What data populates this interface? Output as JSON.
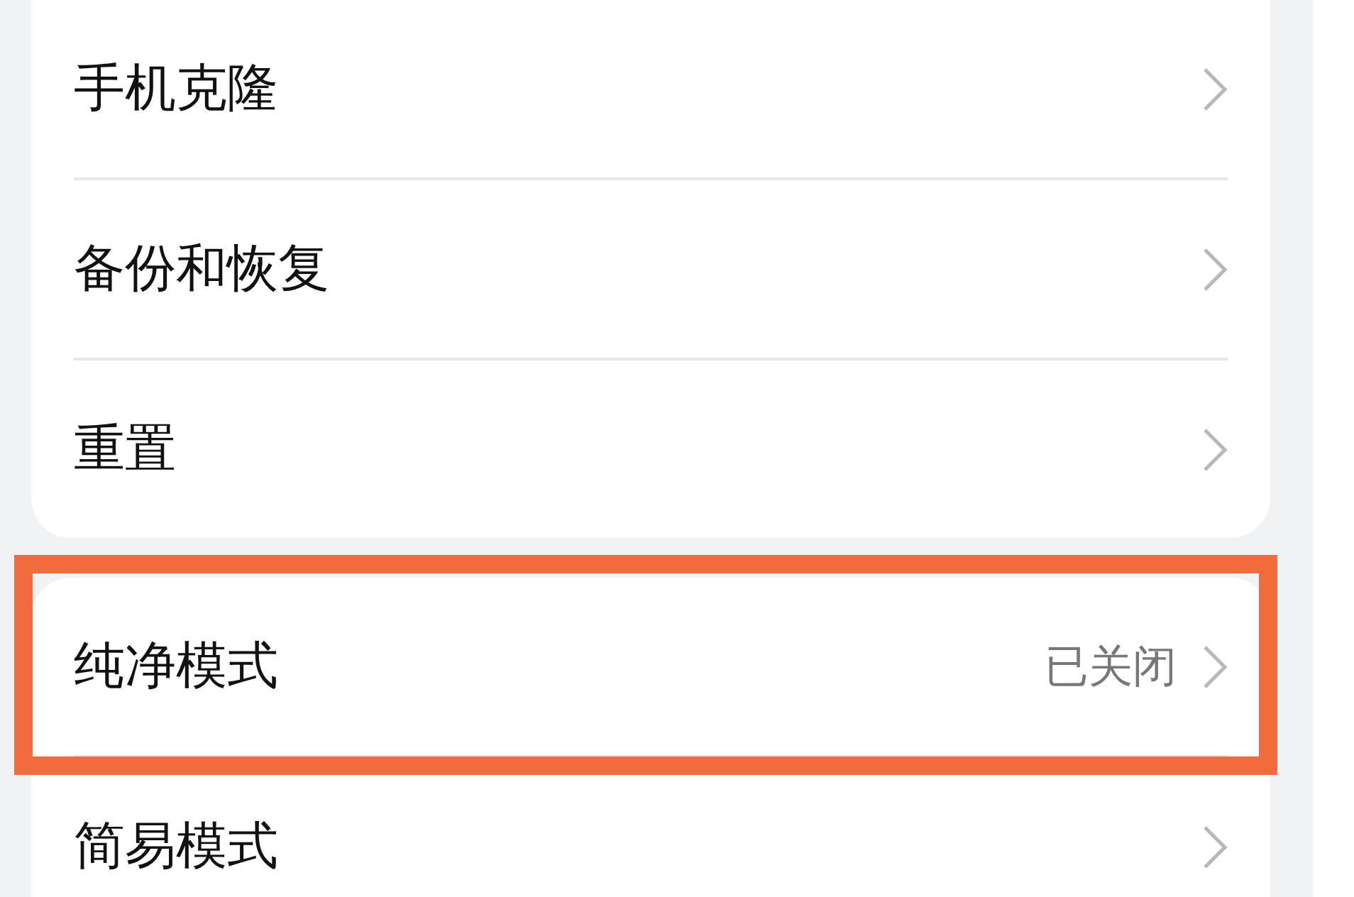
{
  "groups": [
    {
      "items": [
        {
          "label": "手机克隆",
          "highlighted": false
        },
        {
          "label": "备份和恢复",
          "highlighted": false
        },
        {
          "label": "重置",
          "highlighted": false
        }
      ]
    },
    {
      "items": [
        {
          "label": "纯净模式",
          "value": "已关闭",
          "highlighted": true
        },
        {
          "label": "简易模式",
          "highlighted": false
        }
      ]
    }
  ]
}
